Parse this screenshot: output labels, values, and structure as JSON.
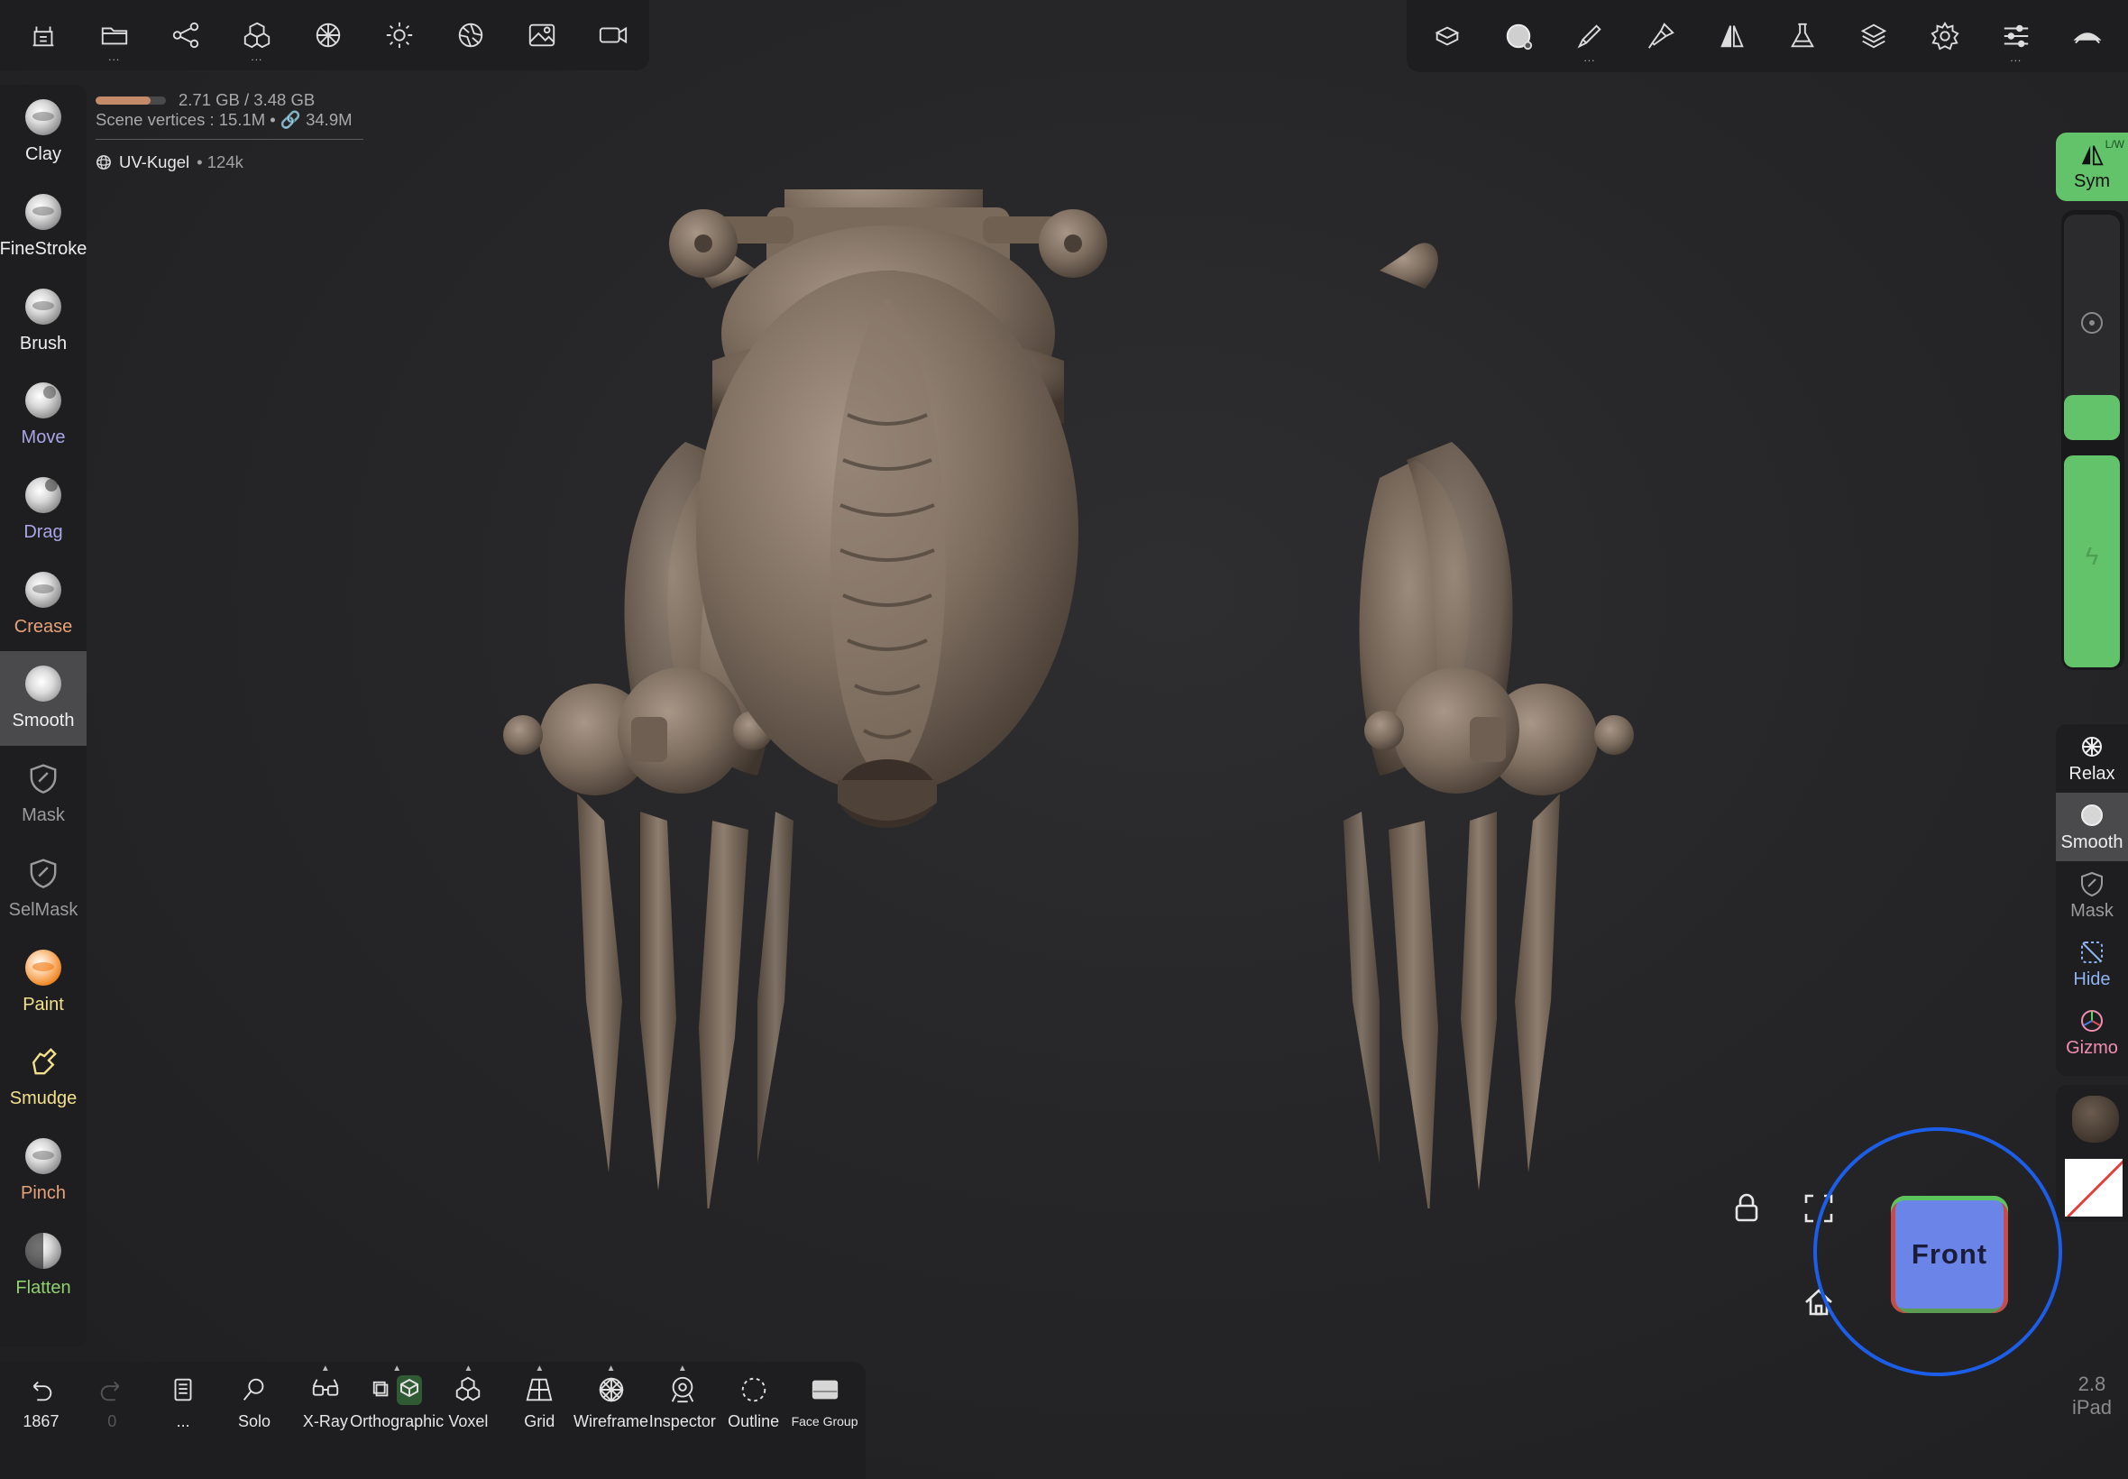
{
  "top_left_toolbar": [
    {
      "name": "scene-icon",
      "dots": false
    },
    {
      "name": "folder-icon",
      "dots": true
    },
    {
      "name": "scene-tree-icon",
      "dots": false
    },
    {
      "name": "multiresolution-icon",
      "dots": true
    },
    {
      "name": "topology-icon",
      "dots": false
    },
    {
      "name": "lighting-icon",
      "dots": false
    },
    {
      "name": "material-icon",
      "dots": false
    },
    {
      "name": "background-image-icon",
      "dots": false
    },
    {
      "name": "camera-icon",
      "dots": false
    }
  ],
  "top_right_toolbar": [
    {
      "name": "tool-brush-settings-icon",
      "dots": false
    },
    {
      "name": "smooth-brush-preview-icon",
      "dots": false
    },
    {
      "name": "stroke-icon",
      "dots": true
    },
    {
      "name": "painting-icon",
      "dots": false
    },
    {
      "name": "symmetry-icon",
      "dots": false
    },
    {
      "name": "flask-icon",
      "dots": false
    },
    {
      "name": "layers-icon",
      "dots": false
    },
    {
      "name": "settings-gear-icon",
      "dots": false
    },
    {
      "name": "sliders-icon",
      "dots": true
    },
    {
      "name": "interface-icon",
      "dots": false
    }
  ],
  "memory": {
    "text": "2.71 GB / 3.48 GB",
    "fraction": 0.78
  },
  "scene_vertices": "Scene vertices : 15.1M • 🔗 34.9M",
  "object": {
    "name": "UV-Kugel",
    "count": "• 124k"
  },
  "tools": [
    {
      "label": "Clay",
      "color": "white",
      "kind": "ball"
    },
    {
      "label": "FineStroke",
      "color": "white",
      "kind": "ball"
    },
    {
      "label": "Brush",
      "color": "white",
      "kind": "ball"
    },
    {
      "label": "Move",
      "color": "violet",
      "kind": "move"
    },
    {
      "label": "Drag",
      "color": "violet",
      "kind": "drag"
    },
    {
      "label": "Crease",
      "color": "orange",
      "kind": "ball"
    },
    {
      "label": "Smooth",
      "color": "white",
      "kind": "smooth",
      "active": true
    },
    {
      "label": "Mask",
      "color": "grey",
      "kind": "mask"
    },
    {
      "label": "SelMask",
      "color": "grey",
      "kind": "selmask"
    },
    {
      "label": "Paint",
      "color": "yellow",
      "kind": "paint"
    },
    {
      "label": "Smudge",
      "color": "yellow",
      "kind": "smudge"
    },
    {
      "label": "Pinch",
      "color": "orange",
      "kind": "ball"
    },
    {
      "label": "Flatten",
      "color": "green",
      "kind": "flat"
    }
  ],
  "right": {
    "sym_label": "Sym",
    "sym_badge": "L/W",
    "radius_fraction": 0.2,
    "intensity_fraction": 1.0,
    "quick_tools": [
      {
        "label": "Relax",
        "color": "white",
        "icon": "relax-icon"
      },
      {
        "label": "Smooth",
        "color": "white",
        "icon": "smooth-icon",
        "active": true
      },
      {
        "label": "Mask",
        "color": "grey",
        "icon": "mask-icon"
      },
      {
        "label": "Hide",
        "color": "blue",
        "icon": "hide-icon"
      },
      {
        "label": "Gizmo",
        "color": "pink",
        "icon": "gizmo-icon"
      }
    ]
  },
  "view_cube": {
    "face": "Front"
  },
  "version": {
    "number": "2.8",
    "device": "iPad"
  },
  "bottom_toolbar": [
    {
      "label": "1867",
      "icon": "undo-icon",
      "dim": false
    },
    {
      "label": "0",
      "icon": "redo-icon",
      "dim": true
    },
    {
      "label": "...",
      "icon": "history-icon",
      "dim": false
    },
    {
      "label": "Solo",
      "icon": "solo-search-icon",
      "dim": false
    },
    {
      "label": "X-Ray",
      "icon": "xray-glasses-icon",
      "dim": false,
      "caret": true
    },
    {
      "label": "Orthographic",
      "icon": "orthographic-icon",
      "dim": false,
      "caret": true
    },
    {
      "label": "Voxel",
      "icon": "voxel-icon",
      "dim": false,
      "caret": true
    },
    {
      "label": "Grid",
      "icon": "grid-icon",
      "dim": false,
      "caret": true
    },
    {
      "label": "Wireframe",
      "icon": "wireframe-icon",
      "dim": false,
      "caret": true
    },
    {
      "label": "Inspector",
      "icon": "inspector-icon",
      "dim": false,
      "caret": true
    },
    {
      "label": "Outline",
      "icon": "outline-icon",
      "dim": false
    },
    {
      "label": "Face Group",
      "icon": "face-group-icon",
      "dim": false,
      "small": true
    }
  ],
  "colors": {
    "accent_green": "#63c36b",
    "cube_ring": "#1d5ee8",
    "panel": "#1e1e20",
    "model": "#7d6d5f"
  }
}
